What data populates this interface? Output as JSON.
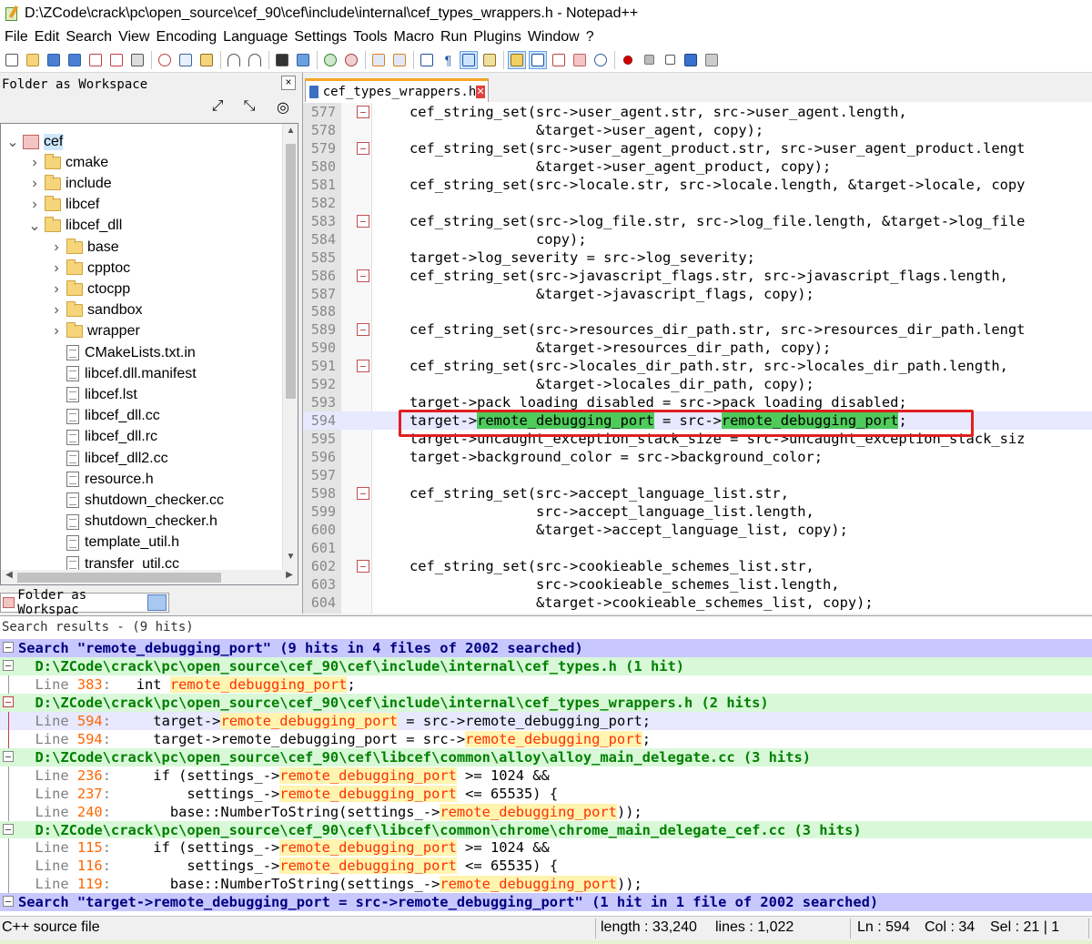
{
  "window": {
    "title": "D:\\ZCode\\crack\\pc\\open_source\\cef_90\\cef\\include\\internal\\cef_types_wrappers.h - Notepad++"
  },
  "menu": [
    "File",
    "Edit",
    "Search",
    "View",
    "Encoding",
    "Language",
    "Settings",
    "Tools",
    "Macro",
    "Run",
    "Plugins",
    "Window",
    "?"
  ],
  "workspace": {
    "header": "Folder as Workspace",
    "close_label": "×",
    "tab_label": "Folder as Workspac",
    "tree": [
      {
        "label": "cef",
        "level": 0,
        "type": "root",
        "expanded": true,
        "selected": true
      },
      {
        "label": "cmake",
        "level": 1,
        "type": "folder",
        "expanded": false
      },
      {
        "label": "include",
        "level": 1,
        "type": "folder",
        "expanded": false
      },
      {
        "label": "libcef",
        "level": 1,
        "type": "folder",
        "expanded": false
      },
      {
        "label": "libcef_dll",
        "level": 1,
        "type": "folder",
        "expanded": true
      },
      {
        "label": "base",
        "level": 2,
        "type": "folder",
        "expanded": false
      },
      {
        "label": "cpptoc",
        "level": 2,
        "type": "folder",
        "expanded": false
      },
      {
        "label": "ctocpp",
        "level": 2,
        "type": "folder",
        "expanded": false
      },
      {
        "label": "sandbox",
        "level": 2,
        "type": "folder",
        "expanded": false
      },
      {
        "label": "wrapper",
        "level": 2,
        "type": "folder",
        "expanded": false
      },
      {
        "label": "CMakeLists.txt.in",
        "level": 2,
        "type": "file"
      },
      {
        "label": "libcef.dll.manifest",
        "level": 2,
        "type": "file"
      },
      {
        "label": "libcef.lst",
        "level": 2,
        "type": "file"
      },
      {
        "label": "libcef_dll.cc",
        "level": 2,
        "type": "file"
      },
      {
        "label": "libcef_dll.rc",
        "level": 2,
        "type": "file"
      },
      {
        "label": "libcef_dll2.cc",
        "level": 2,
        "type": "file"
      },
      {
        "label": "resource.h",
        "level": 2,
        "type": "file"
      },
      {
        "label": "shutdown_checker.cc",
        "level": 2,
        "type": "file"
      },
      {
        "label": "shutdown_checker.h",
        "level": 2,
        "type": "file"
      },
      {
        "label": "template_util.h",
        "level": 2,
        "type": "file"
      },
      {
        "label": "transfer_util.cc",
        "level": 2,
        "type": "file"
      }
    ]
  },
  "editor": {
    "tab_label": "cef_types_wrappers.h",
    "current_line": 594,
    "lines": [
      {
        "n": 577,
        "fold": true,
        "text": "cef_string_set(src->user_agent.str, src->user_agent.length,"
      },
      {
        "n": 578,
        "fold": false,
        "text": "               &target->user_agent, copy);"
      },
      {
        "n": 579,
        "fold": true,
        "text": "cef_string_set(src->user_agent_product.str, src->user_agent_product.lengt"
      },
      {
        "n": 580,
        "fold": false,
        "text": "               &target->user_agent_product, copy);"
      },
      {
        "n": 581,
        "fold": false,
        "text": "cef_string_set(src->locale.str, src->locale.length, &target->locale, copy"
      },
      {
        "n": 582,
        "fold": false,
        "text": ""
      },
      {
        "n": 583,
        "fold": true,
        "text": "cef_string_set(src->log_file.str, src->log_file.length, &target->log_file"
      },
      {
        "n": 584,
        "fold": false,
        "text": "               copy);"
      },
      {
        "n": 585,
        "fold": false,
        "text": "target->log_severity = src->log_severity;"
      },
      {
        "n": 586,
        "fold": true,
        "text": "cef_string_set(src->javascript_flags.str, src->javascript_flags.length,"
      },
      {
        "n": 587,
        "fold": false,
        "text": "               &target->javascript_flags, copy);"
      },
      {
        "n": 588,
        "fold": false,
        "text": ""
      },
      {
        "n": 589,
        "fold": true,
        "text": "cef_string_set(src->resources_dir_path.str, src->resources_dir_path.lengt"
      },
      {
        "n": 590,
        "fold": false,
        "text": "               &target->resources_dir_path, copy);"
      },
      {
        "n": 591,
        "fold": true,
        "text": "cef_string_set(src->locales_dir_path.str, src->locales_dir_path.length,"
      },
      {
        "n": 592,
        "fold": false,
        "text": "               &target->locales_dir_path, copy);"
      },
      {
        "n": 593,
        "fold": false,
        "text": "target->pack_loading_disabled = src->pack_loading_disabled;"
      },
      {
        "n": 594,
        "fold": false,
        "text": "target->remote_debugging_port = src->remote_debugging_port;"
      },
      {
        "n": 595,
        "fold": false,
        "text": "target->uncaught_exception_stack_size = src->uncaught_exception_stack_siz"
      },
      {
        "n": 596,
        "fold": false,
        "text": "target->background_color = src->background_color;"
      },
      {
        "n": 597,
        "fold": false,
        "text": ""
      },
      {
        "n": 598,
        "fold": true,
        "text": "cef_string_set(src->accept_language_list.str,"
      },
      {
        "n": 599,
        "fold": false,
        "text": "               src->accept_language_list.length,"
      },
      {
        "n": 600,
        "fold": false,
        "text": "               &target->accept_language_list, copy);"
      },
      {
        "n": 601,
        "fold": false,
        "text": ""
      },
      {
        "n": 602,
        "fold": true,
        "text": "cef_string_set(src->cookieable_schemes_list.str,"
      },
      {
        "n": 603,
        "fold": false,
        "text": "               src->cookieable_schemes_list.length,"
      },
      {
        "n": 604,
        "fold": false,
        "text": "               &target->cookieable_schemes_list, copy);"
      }
    ],
    "line_594": {
      "pre": "target->",
      "m1": "remote_debugging_port",
      "mid": " = src->",
      "m2": "remote_debugging_port",
      "post": ";"
    }
  },
  "search": {
    "title": "Search results - (9 hits)",
    "rows": [
      {
        "kind": "head",
        "text": "Search \"remote_debugging_port\" (9 hits in 4 files of 2002 searched)"
      },
      {
        "kind": "file",
        "text": "  D:\\ZCode\\crack\\pc\\open_source\\cef_90\\cef\\include\\internal\\cef_types.h (1 hit)"
      },
      {
        "kind": "line",
        "lineno": "383",
        "pre": "   int ",
        "match": "remote_debugging_port",
        "post": ";"
      },
      {
        "kind": "file",
        "red": true,
        "text": "  D:\\ZCode\\crack\\pc\\open_source\\cef_90\\cef\\include\\internal\\cef_types_wrappers.h (2 hits)"
      },
      {
        "kind": "line",
        "red": true,
        "cur": true,
        "lineno": "594",
        "pre": "     target->",
        "match": "remote_debugging_port",
        "post": " = src->remote_debugging_port;"
      },
      {
        "kind": "line",
        "red": true,
        "lineno": "594",
        "pre": "     target->remote_debugging_port = src->",
        "match": "remote_debugging_port",
        "post": ";"
      },
      {
        "kind": "file",
        "text": "  D:\\ZCode\\crack\\pc\\open_source\\cef_90\\cef\\libcef\\common\\alloy\\alloy_main_delegate.cc (3 hits)"
      },
      {
        "kind": "line",
        "lineno": "236",
        "pre": "     if (settings_->",
        "match": "remote_debugging_port",
        "post": " >= 1024 &&"
      },
      {
        "kind": "line",
        "lineno": "237",
        "pre": "         settings_->",
        "match": "remote_debugging_port",
        "post": " <= 65535) {"
      },
      {
        "kind": "line",
        "lineno": "240",
        "pre": "       base::NumberToString(settings_->",
        "match": "remote_debugging_port",
        "post": "));"
      },
      {
        "kind": "file",
        "text": "  D:\\ZCode\\crack\\pc\\open_source\\cef_90\\cef\\libcef\\common\\chrome\\chrome_main_delegate_cef.cc (3 hits)"
      },
      {
        "kind": "line",
        "lineno": "115",
        "pre": "     if (settings_->",
        "match": "remote_debugging_port",
        "post": " >= 1024 &&"
      },
      {
        "kind": "line",
        "lineno": "116",
        "pre": "         settings_->",
        "match": "remote_debugging_port",
        "post": " <= 65535) {"
      },
      {
        "kind": "line",
        "lineno": "119",
        "pre": "       base::NumberToString(settings_->",
        "match": "remote_debugging_port",
        "post": "));"
      },
      {
        "kind": "head",
        "text": "Search \"target->remote_debugging_port = src->remote_debugging_port\" (1 hit in 1 file of 2002 searched)"
      }
    ]
  },
  "status": {
    "filetype": "C++ source file",
    "length": "length : 33,240",
    "lines": "lines : 1,022",
    "ln": "Ln : 594",
    "col": "Col : 34",
    "sel": "Sel : 21 | 1"
  }
}
